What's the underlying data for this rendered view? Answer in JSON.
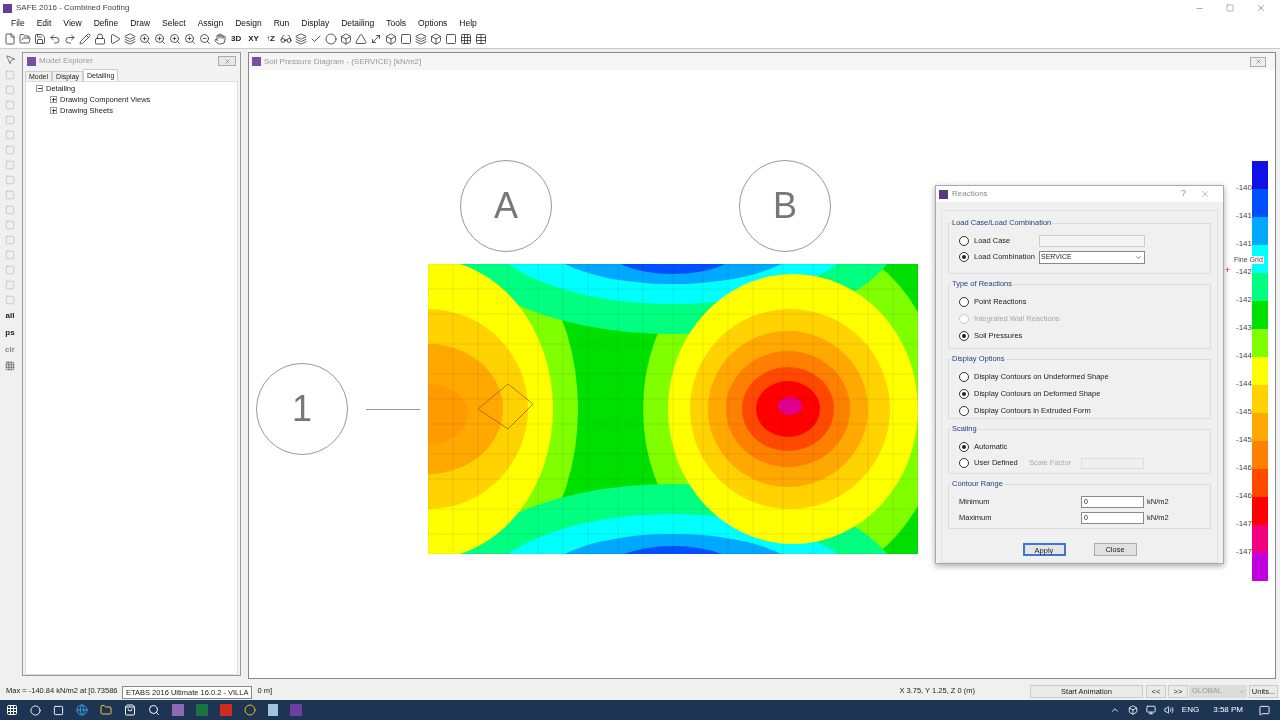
{
  "window": {
    "title": "SAFE 2016 - Combined Footing"
  },
  "menu": [
    "File",
    "Edit",
    "View",
    "Define",
    "Draw",
    "Select",
    "Assign",
    "Design",
    "Run",
    "Display",
    "Detailing",
    "Tools",
    "Options",
    "Help"
  ],
  "toolbar_labels": [
    "3D",
    "XY",
    "↑Z"
  ],
  "side_tools": [
    "all",
    "ps",
    "clr"
  ],
  "model_explorer": {
    "title": "Model Explorer",
    "tabs": [
      {
        "label": "Model",
        "selected": false
      },
      {
        "label": "Display",
        "selected": false
      },
      {
        "label": "Detailing",
        "selected": true
      }
    ],
    "tree": [
      {
        "label": "Detailing",
        "expanded": true,
        "children": [
          {
            "label": "Drawing Component Views",
            "expanded": false
          },
          {
            "label": "Drawing Sheets",
            "expanded": false
          }
        ]
      }
    ]
  },
  "view": {
    "title": "Soil Pressure Diagram - (SERVICE)  [kN/m2]",
    "grid_bubbles": [
      {
        "label": "A"
      },
      {
        "label": "B"
      },
      {
        "label": "1"
      }
    ]
  },
  "legend": {
    "note": "Fine Grid",
    "cursor": "+",
    "bands": [
      {
        "color": "#1010e8"
      },
      {
        "color": "#0050ff"
      },
      {
        "color": "#00a8ff"
      },
      {
        "color": "#00ffff"
      },
      {
        "color": "#00ff80"
      },
      {
        "color": "#00e000"
      },
      {
        "color": "#80ff00"
      },
      {
        "color": "#ffff00"
      },
      {
        "color": "#ffd200"
      },
      {
        "color": "#ffa800"
      },
      {
        "color": "#ff7f00"
      },
      {
        "color": "#ff4800"
      },
      {
        "color": "#ff0000"
      },
      {
        "color": "#f0007f"
      },
      {
        "color": "#c000e0"
      }
    ],
    "ticks": [
      "-140",
      "-141",
      "-141",
      "-142",
      "-142",
      "-143",
      "-144",
      "-144",
      "-145",
      "-145",
      "-146",
      "-146",
      "-147",
      "-147"
    ]
  },
  "dialog": {
    "title": "Reactions",
    "help": "?",
    "load_group": {
      "title": "Load Case/Load Combination",
      "options": [
        {
          "label": "Load Case",
          "selected": false,
          "disabled": false
        },
        {
          "label": "Load Combination",
          "selected": true,
          "disabled": false
        }
      ],
      "combination_value": "SERVICE"
    },
    "reaction_group": {
      "title": "Type of Reactions",
      "options": [
        {
          "label": "Point Reactions",
          "selected": false,
          "disabled": false
        },
        {
          "label": "Integrated Wall Reactions",
          "selected": false,
          "disabled": true
        },
        {
          "label": "Soil Pressures",
          "selected": true,
          "disabled": false
        }
      ]
    },
    "display_group": {
      "title": "Display Options",
      "options": [
        {
          "label": "Display Contours on Undeformed Shape",
          "selected": false,
          "disabled": false
        },
        {
          "label": "Display Contours on Deformed Shape",
          "selected": true,
          "disabled": false
        },
        {
          "label": "Display Contours in Extruded Form",
          "selected": false,
          "disabled": false
        }
      ]
    },
    "scaling_group": {
      "title": "Scaling",
      "options": [
        {
          "label": "Automatic",
          "selected": true,
          "disabled": false
        },
        {
          "label": "User Defined",
          "selected": false,
          "disabled": false
        }
      ],
      "scale_factor_label": "Scale Factor"
    },
    "range_group": {
      "title": "Contour Range",
      "rows": [
        {
          "label": "Minimum",
          "value": "0",
          "unit": "kN/m2"
        },
        {
          "label": "Maximum",
          "value": "0",
          "unit": "kN/m2"
        }
      ]
    },
    "buttons": [
      {
        "label": "Apply",
        "default": true
      },
      {
        "label": "Close",
        "default": false
      }
    ]
  },
  "status_bar": {
    "max_text": "Max = -140.84 kN/m2 at [0.73586",
    "max_tail": "0 m]",
    "coordinates": "X 3.75,  Y 1.25,  Z 0  (m)",
    "animation": "Start Animation",
    "prev": "<<",
    "next": ">>",
    "system": "GLOBAL",
    "units": "Units..."
  },
  "tooltip": "ETABS 2016 Ultimate 16.0.2 - VILLA",
  "taskbar": {
    "language": "ENG",
    "time": "3:58 PM"
  }
}
